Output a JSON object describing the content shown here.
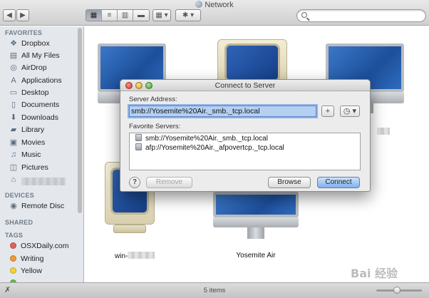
{
  "window": {
    "title": "Network"
  },
  "toolbar": {
    "back_glyph": "◀",
    "forward_glyph": "▶",
    "view_modes": [
      {
        "name": "icon-view",
        "glyph": "▦",
        "active": true
      },
      {
        "name": "list-view",
        "glyph": "≡",
        "active": false
      },
      {
        "name": "column-view",
        "glyph": "▥",
        "active": false
      },
      {
        "name": "coverflow-view",
        "glyph": "▬",
        "active": false
      }
    ],
    "arrange_glyph": "▦ ▾",
    "action_glyph": "✱ ▾",
    "search": {
      "value": "",
      "placeholder": ""
    }
  },
  "sidebar": {
    "favorites_header": "FAVORITES",
    "favorites": [
      {
        "label": "Dropbox",
        "icon": "dropbox-icon",
        "glyph": "❖"
      },
      {
        "label": "All My Files",
        "icon": "all-files-icon",
        "glyph": "▤"
      },
      {
        "label": "AirDrop",
        "icon": "airdrop-icon",
        "glyph": "◎"
      },
      {
        "label": "Applications",
        "icon": "applications-icon",
        "glyph": "A"
      },
      {
        "label": "Desktop",
        "icon": "desktop-icon",
        "glyph": "▭"
      },
      {
        "label": "Documents",
        "icon": "documents-icon",
        "glyph": "▯"
      },
      {
        "label": "Downloads",
        "icon": "downloads-icon",
        "glyph": "⬇"
      },
      {
        "label": "Library",
        "icon": "folder-icon",
        "glyph": "▰"
      },
      {
        "label": "Movies",
        "icon": "movies-icon",
        "glyph": "▣"
      },
      {
        "label": "Music",
        "icon": "music-icon",
        "glyph": "♫"
      },
      {
        "label": "Pictures",
        "icon": "pictures-icon",
        "glyph": "◫"
      }
    ],
    "devices_header": "DEVICES",
    "devices": [
      {
        "label": "Remote Disc",
        "icon": "remote-disc-icon",
        "glyph": "◉"
      }
    ],
    "shared_header": "SHARED",
    "tags_header": "TAGS",
    "tags": [
      {
        "label": "OSXDaily.com",
        "color": "#e0625c"
      },
      {
        "label": "Writing",
        "color": "#f19a3a"
      },
      {
        "label": "Yellow",
        "color": "#f3d23b"
      }
    ]
  },
  "computers": [
    {
      "label": "",
      "kind": "imac"
    },
    {
      "label": "",
      "kind": "crt"
    },
    {
      "label": "",
      "kind": "imac"
    },
    {
      "label": "win-",
      "kind": "crt"
    },
    {
      "label": "Yosemite Air",
      "kind": "imac"
    }
  ],
  "dialog": {
    "title": "Connect to Server",
    "server_address_label": "Server Address:",
    "server_address_value": "smb://Yosemite%20Air._smb._tcp.local",
    "add_glyph": "+",
    "recent_glyph": "◷ ▾",
    "favorite_servers_label": "Favorite Servers:",
    "favorite_servers": [
      "smb://Yosemite%20Air._smb._tcp.local",
      "afp://Yosemite%20Air._afpovertcp._tcp.local"
    ],
    "help_glyph": "?",
    "remove_label": "Remove",
    "browse_label": "Browse",
    "connect_label": "Connect"
  },
  "statusbar": {
    "items_text": "5 items",
    "tool_glyph": "✗",
    "icon_size_level": 0.45
  },
  "watermark": "Bai 经验"
}
